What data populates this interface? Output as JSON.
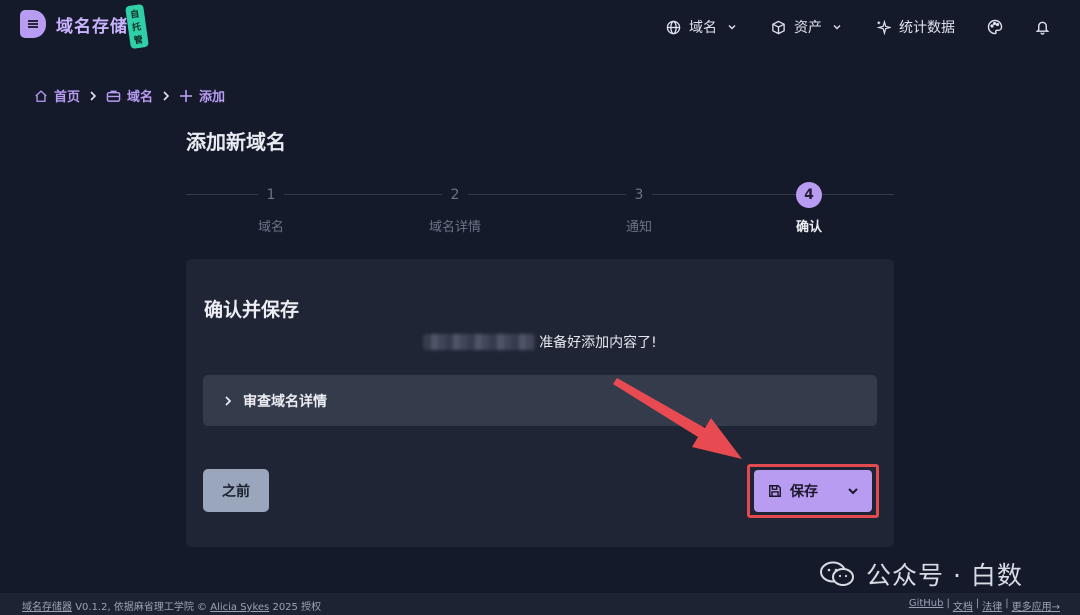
{
  "app": {
    "name": "域名存储器",
    "badge": "自托管"
  },
  "nav": {
    "domains": "域名",
    "assets": "资产",
    "stats": "统计数据"
  },
  "breadcrumb": {
    "home": "首页",
    "domains": "域名",
    "add": "添加"
  },
  "page": {
    "title": "添加新域名"
  },
  "stepper": {
    "steps": [
      {
        "num": "1",
        "label": "域名"
      },
      {
        "num": "2",
        "label": "域名详情"
      },
      {
        "num": "3",
        "label": "通知"
      },
      {
        "num": "4",
        "label": "确认"
      }
    ],
    "active_index": 3
  },
  "card": {
    "title": "确认并保存",
    "ready_text": "准备好添加内容了!",
    "review_label": "审查域名详情",
    "prev_button": "之前",
    "save_button": "保存"
  },
  "footer": {
    "app": "域名存储器",
    "version": "V0.1.2,",
    "licensed": "依据麻省理工学院 ©",
    "author": "Alicia Sykes",
    "year": "2025 授权",
    "links": [
      "GitHub",
      "文档",
      "法律",
      "更多应用→"
    ]
  },
  "watermark": {
    "text": "公众号 · 白数"
  },
  "colors": {
    "accent": "#b89cf2",
    "background": "#151a2b",
    "card": "#1f2535",
    "highlight": "#e34a4f"
  },
  "icons": [
    "globe-icon",
    "cube-icon",
    "sparkle-icon",
    "palette-icon",
    "bell-icon",
    "home-icon",
    "briefcase-icon",
    "plus-icon",
    "chevron-right-icon",
    "save-icon",
    "chevron-down-icon"
  ]
}
